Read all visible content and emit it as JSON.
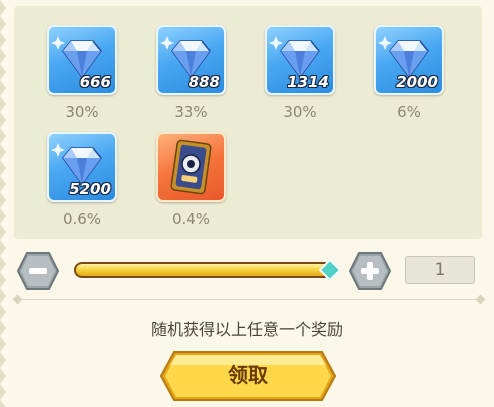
{
  "rewards": [
    {
      "icon": "diamond-icon",
      "count": "666",
      "rate": "30%"
    },
    {
      "icon": "diamond-icon",
      "count": "888",
      "rate": "33%"
    },
    {
      "icon": "diamond-icon",
      "count": "1314",
      "rate": "30%"
    },
    {
      "icon": "diamond-icon",
      "count": "2000",
      "rate": "6%"
    },
    {
      "icon": "diamond-icon",
      "count": "5200",
      "rate": "0.6%"
    },
    {
      "icon": "card-pack-icon",
      "count": "",
      "rate": "0.4%"
    }
  ],
  "quantity": {
    "value": "1",
    "slider_fraction": 1.0,
    "minus_icon": "minus-icon",
    "plus_icon": "plus-icon"
  },
  "description": "随机获得以上任意一个奖励",
  "claim_button": {
    "label": "领取"
  },
  "colors": {
    "accent": "#f5cf3a",
    "tile_blue": "#49a7f2",
    "tile_orange": "#f4743b",
    "knob": "#4fd1c5"
  }
}
